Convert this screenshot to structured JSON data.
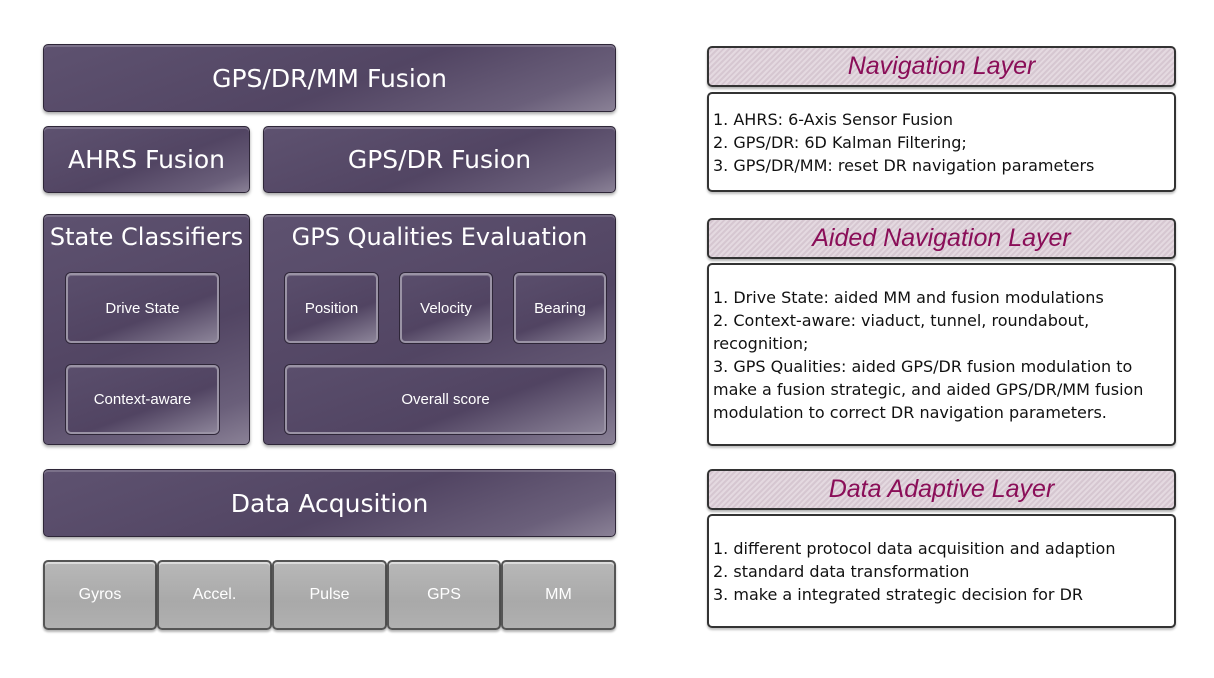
{
  "architecture": {
    "top": "GPS/DR/MM Fusion",
    "ahrs": "AHRS Fusion",
    "gpsdr": "GPS/DR Fusion",
    "state_classifiers": {
      "title": "State Classifiers",
      "items": [
        "Drive State",
        "Context-aware"
      ]
    },
    "gps_qualities": {
      "title": "GPS Qualities Evaluation",
      "items": [
        "Position",
        "Velocity",
        "Bearing"
      ],
      "overall": "Overall score"
    },
    "data_acquisition": "Data Acqusition",
    "sensors": [
      "Gyros",
      "Accel.",
      "Pulse",
      "GPS",
      "MM"
    ]
  },
  "layers": [
    {
      "title": "Navigation Layer",
      "lines": [
        "1. AHRS: 6-Axis Sensor Fusion",
        "2. GPS/DR: 6D Kalman Filtering;",
        "3. GPS/DR/MM: reset DR navigation parameters"
      ]
    },
    {
      "title": "Aided Navigation Layer",
      "lines": [
        "1. Drive State: aided MM and fusion modulations",
        "2. Context-aware: viaduct, tunnel, roundabout,",
        "recognition;",
        "3. GPS Qualities: aided GPS/DR fusion modulation to",
        "make a fusion strategic, and aided GPS/DR/MM fusion",
        "modulation to correct DR navigation parameters."
      ]
    },
    {
      "title": "Data Adaptive Layer",
      "lines": [
        "1. different protocol data acquisition and adaption",
        "2. standard data transformation",
        "3. make a integrated strategic decision for DR"
      ]
    }
  ],
  "colors": {
    "purple": "#564a66",
    "grey": "#ababab",
    "header_text": "#8a0e58",
    "header_bg": "#ddd0d9"
  }
}
